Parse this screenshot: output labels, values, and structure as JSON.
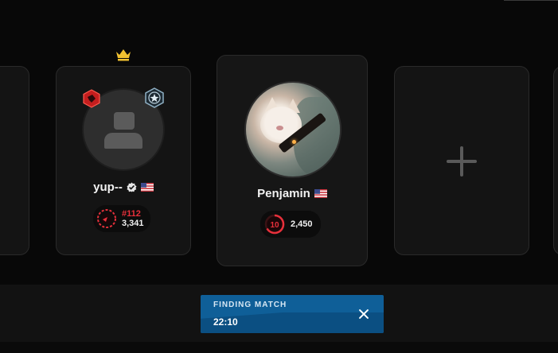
{
  "party": {
    "player1": {
      "name": "yup--",
      "verified_icon": "verified-check-icon",
      "flag": "us-flag-icon",
      "rank_position": "#112",
      "elo": "3,341",
      "is_leader": true
    },
    "player2": {
      "name": "Penjamin",
      "flag": "us-flag-icon",
      "skill_level": "10",
      "elo": "2,450"
    },
    "add_slot_icon": "plus-icon"
  },
  "matchmaking": {
    "status_label": "FINDING MATCH",
    "timer": "22:10",
    "close_icon": "close-icon"
  },
  "colors": {
    "card_bg": "#141414",
    "accent_red": "#e8303b",
    "finding_blue": "#0f5f98",
    "crown_gold": "#f2c230"
  }
}
